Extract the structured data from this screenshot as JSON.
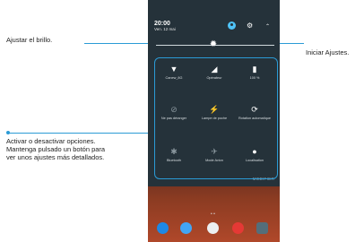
{
  "callouts": {
    "brightness": "Ajustar el brillo.",
    "settings": "Iniciar Ajustes.",
    "toggle_line1": "Activar o desactivar opciones.",
    "toggle_line2": "Mantenga pulsado un botón para",
    "toggle_line3": "ver unos ajustes más detallados."
  },
  "phone": {
    "time": "20:00",
    "date": "Ven. 12 mai",
    "modifier_label": "MODIFIER",
    "tiles": [
      {
        "label": "Canew_8G",
        "icon": "wifi-icon",
        "glyph": "▼",
        "active": true
      },
      {
        "label": "Opérateur",
        "icon": "signal-icon",
        "glyph": "◢",
        "active": true
      },
      {
        "label": "100 %",
        "icon": "battery-icon",
        "glyph": "▮",
        "active": true
      },
      {
        "label": "Ne pas déranger",
        "icon": "do-not-disturb-icon",
        "glyph": "⊘",
        "active": false
      },
      {
        "label": "Lampe de poche",
        "icon": "flashlight-icon",
        "glyph": "⚡",
        "active": false
      },
      {
        "label": "Rotation automatique",
        "icon": "auto-rotate-icon",
        "glyph": "⟳",
        "active": true
      },
      {
        "label": "Bluetooth",
        "icon": "bluetooth-icon",
        "glyph": "✱",
        "active": false
      },
      {
        "label": "Mode Avion",
        "icon": "airplane-mode-icon",
        "glyph": "✈",
        "active": false
      },
      {
        "label": "Localisation",
        "icon": "location-icon",
        "glyph": "●",
        "active": true
      }
    ]
  },
  "colors": {
    "accent": "#2b9bd6",
    "panel": "#25323a"
  }
}
